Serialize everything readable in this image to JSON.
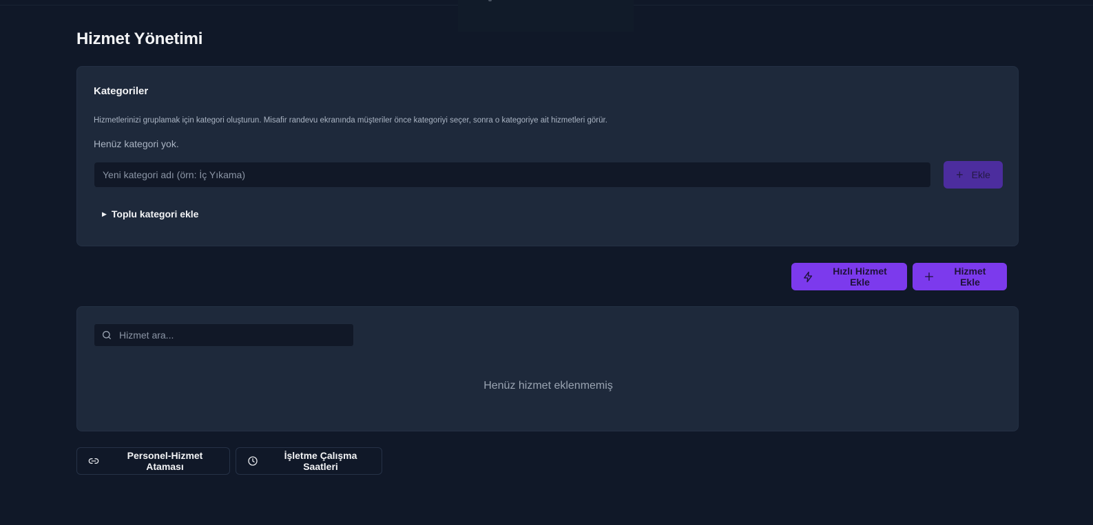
{
  "page": {
    "title": "Hizmet Yönetimi"
  },
  "categories": {
    "title": "Kategoriler",
    "description": "Hizmetlerinizi gruplamak için kategori oluşturun. Misafir randevu ekranında müşteriler önce kategoriyi seçer, sonra o kategoriye ait hizmetleri görür.",
    "empty_text": "Henüz kategori yok.",
    "input_placeholder": "Yeni kategori adı (örn: İç Yıkama)",
    "add_button": {
      "label": "Ekle",
      "icon": "plus-icon"
    },
    "bulk_toggle": {
      "label": "Toplu kategori ekle",
      "icon": "triangle-right-icon"
    }
  },
  "actions": {
    "quick_add": {
      "label": "Hızlı Hizmet Ekle",
      "icon": "lightning-icon"
    },
    "add_service": {
      "label": "Hizmet Ekle",
      "icon": "plus-icon"
    }
  },
  "services": {
    "search_placeholder": "Hizmet ara...",
    "search_icon": "search-icon",
    "empty_text": "Henüz hizmet eklenmemiş"
  },
  "footer_links": [
    {
      "label": "Personel-Hizmet Ataması",
      "icon": "link-icon"
    },
    {
      "label": "İşletme Çalışma Saatleri",
      "icon": "clock-icon"
    }
  ],
  "colors": {
    "background": "#101828",
    "card": "#1e293b",
    "accent": "#7c3aed",
    "accent_disabled": "#4c2d9e",
    "input": "#111827"
  }
}
